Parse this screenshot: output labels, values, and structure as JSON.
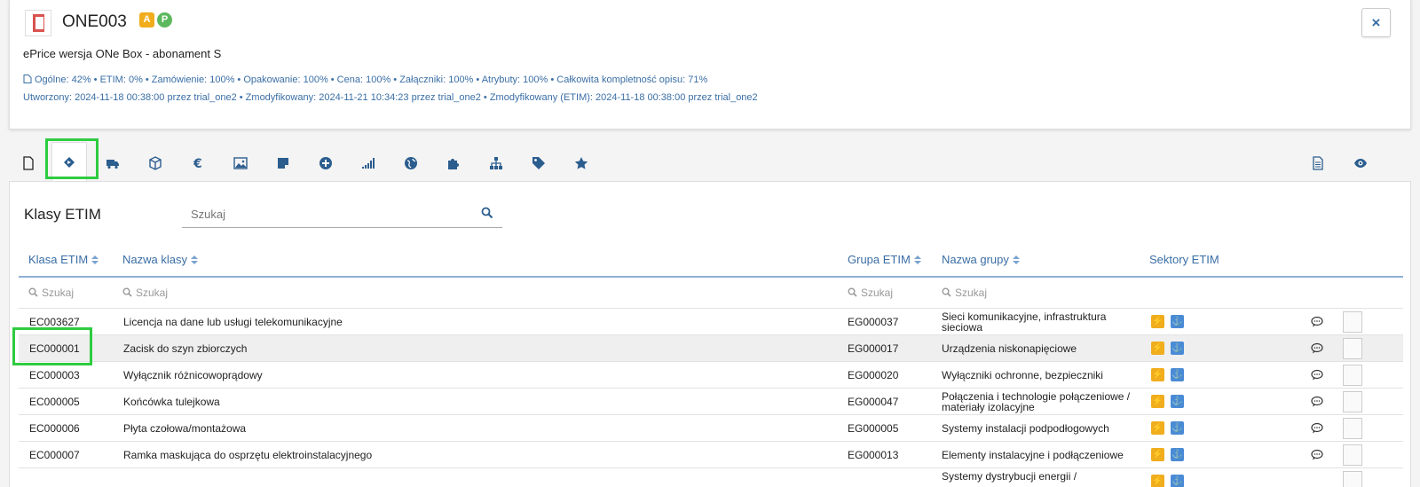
{
  "product": {
    "code": "ONE003",
    "badges": [
      "A",
      "P"
    ],
    "name": "ePrice wersja ONe Box - abonament S",
    "stats_line1": "Ogólne: 42%  •  ETIM: 0%  •  Zamówienie: 100%  •  Opakowanie: 100%  •  Cena: 100%  •  Załączniki: 100%  •  Atrybuty: 100%  •  Całkowita kompletność opisu: 71%",
    "stats_line2": "Utworzony: 2024-11-18 00:38:00 przez trial_one2  •  Zmodyfikowany: 2024-11-21 10:34:23 przez trial_one2  •  Zmodyfikowany (ETIM): 2024-11-18 00:38:00 przez trial_one2"
  },
  "close_label": "×",
  "tabs": [
    {
      "icon": "file-icon"
    },
    {
      "icon": "etim-icon",
      "active": true
    },
    {
      "icon": "truck-icon"
    },
    {
      "icon": "box-icon"
    },
    {
      "icon": "euro-icon"
    },
    {
      "icon": "image-icon"
    },
    {
      "icon": "sticky-note-icon"
    },
    {
      "icon": "plus-circle-icon"
    },
    {
      "icon": "signal-icon"
    },
    {
      "icon": "globe-icon"
    },
    {
      "icon": "puzzle-icon"
    },
    {
      "icon": "sitemap-icon"
    },
    {
      "icon": "tag-icon"
    },
    {
      "icon": "star-icon"
    }
  ],
  "right_tabs": [
    {
      "icon": "document-icon"
    },
    {
      "icon": "eye-icon"
    }
  ],
  "panel": {
    "title": "Klasy ETIM",
    "search_placeholder": "Szukaj"
  },
  "table": {
    "headers": {
      "klasa": "Klasa ETIM",
      "nazwa_klasy": "Nazwa klasy",
      "grupa": "Grupa ETIM",
      "nazwa_grupy": "Nazwa grupy",
      "sektory": "Sektory ETIM"
    },
    "filter_placeholder": "Szukaj",
    "rows": [
      {
        "klasa": "EC003627",
        "nazwa": "Licencja na dane lub usługi telekomunikacyjne",
        "grupa": "EG000037",
        "nazwa_grupy": "Sieci komunikacyjne, infrastruktura sieciowa"
      },
      {
        "klasa": "EC000001",
        "nazwa": "Zacisk do szyn zbiorczych",
        "grupa": "EG000017",
        "nazwa_grupy": "Urządzenia niskonapięciowe",
        "selected": true
      },
      {
        "klasa": "EC000003",
        "nazwa": "Wyłącznik różnicowoprądowy",
        "grupa": "EG000020",
        "nazwa_grupy": "Wyłączniki ochronne, bezpieczniki"
      },
      {
        "klasa": "EC000005",
        "nazwa": "Końcówka tulejkowa",
        "grupa": "EG000047",
        "nazwa_grupy": "Połączenia i technologie połączeniowe / materiały izolacyjne"
      },
      {
        "klasa": "EC000006",
        "nazwa": "Płyta czołowa/montażowa",
        "grupa": "EG000005",
        "nazwa_grupy": "Systemy instalacji podpodłogowych"
      },
      {
        "klasa": "EC000007",
        "nazwa": "Ramka maskująca do osprzętu elektroinstalacyjnego",
        "grupa": "EG000013",
        "nazwa_grupy": "Elementy instalacyjne i podłączeniowe"
      },
      {
        "klasa": "",
        "nazwa": "",
        "grupa": "",
        "nazwa_grupy": "Systemy dystrybucji energii /"
      }
    ]
  },
  "colors": {
    "accent": "#3a6ea5",
    "bolt": "#f0ad1e",
    "anchor": "#4a8bd6",
    "highlight": "#2ecc40"
  }
}
